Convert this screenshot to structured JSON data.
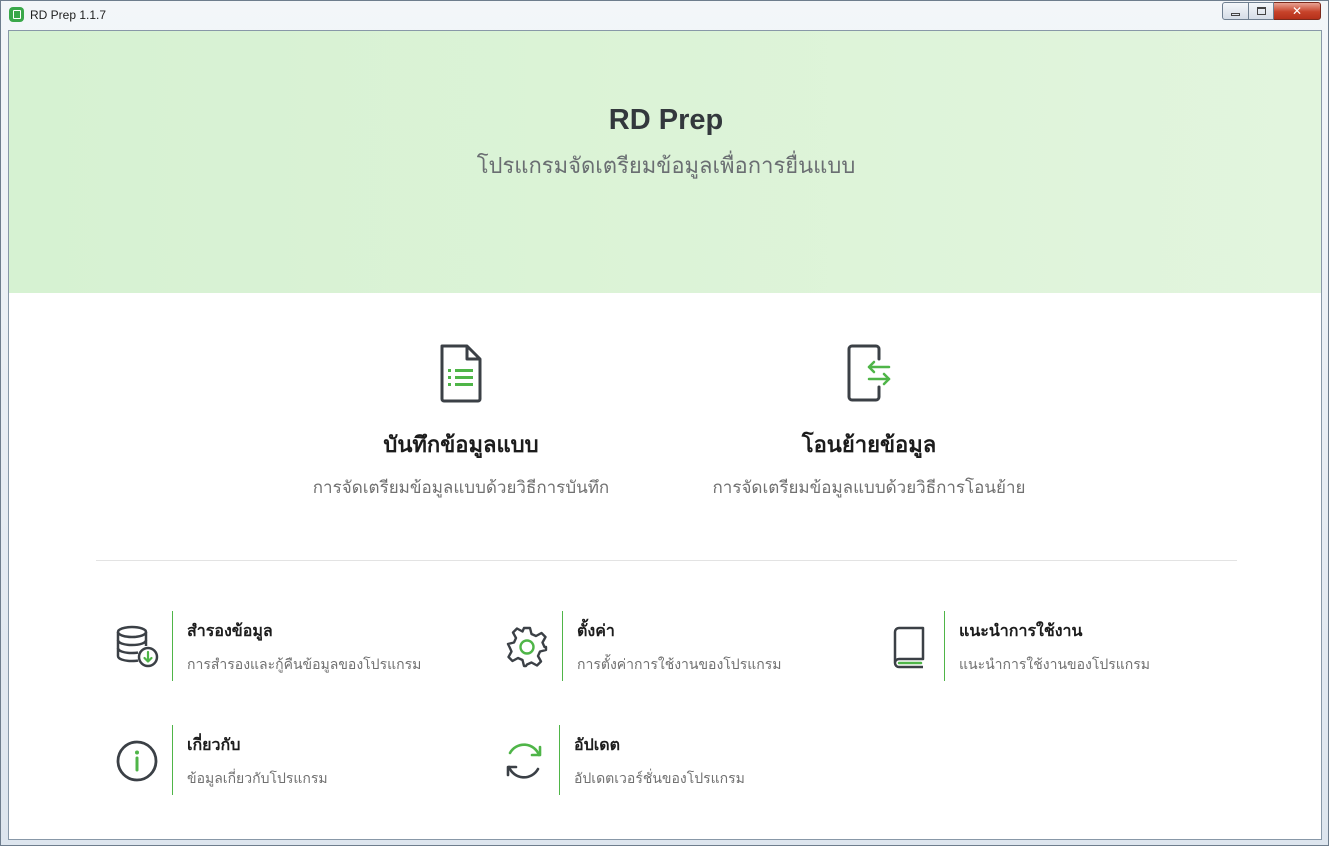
{
  "window": {
    "title": "RD Prep 1.1.7",
    "controls": {
      "minimize": "",
      "maximize": "",
      "close": "✕"
    }
  },
  "hero": {
    "title": "RD Prep",
    "subtitle": "โปรแกรมจัดเตรียมข้อมูลเพื่อการยื่นแบบ"
  },
  "main_actions": [
    {
      "label": "บันทึกข้อมูลแบบ",
      "description": "การจัดเตรียมข้อมูลแบบด้วยวิธีการบันทึก",
      "icon": "document-list-icon"
    },
    {
      "label": "โอนย้ายข้อมูล",
      "description": "การจัดเตรียมข้อมูลแบบด้วยวิธีการโอนย้าย",
      "icon": "device-transfer-icon"
    }
  ],
  "sub_actions": [
    {
      "label": "สำรองข้อมูล",
      "description": "การสำรองและกู้คืนข้อมูลของโปรแกรม",
      "icon": "database-download-icon"
    },
    {
      "label": "ตั้งค่า",
      "description": "การตั้งค่าการใช้งานของโปรแกรม",
      "icon": "gear-icon"
    },
    {
      "label": "แนะนำการใช้งาน",
      "description": "แนะนำการใช้งานของโปรแกรม",
      "icon": "book-icon"
    },
    {
      "label": "เกี่ยวกับ",
      "description": "ข้อมูลเกี่ยวกับโปรแกรม",
      "icon": "info-icon"
    },
    {
      "label": "อัปเดต",
      "description": "อัปเดตเวอร์ชั่นของโปรแกรม",
      "icon": "refresh-icon"
    }
  ],
  "colors": {
    "accent": "#4fb548",
    "icon_dark": "#3b4046",
    "hero_bg": "#dcf3d7"
  }
}
